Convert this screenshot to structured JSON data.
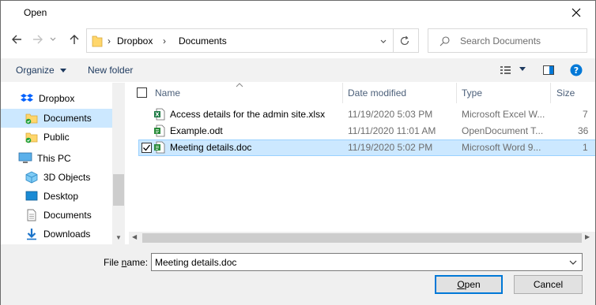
{
  "window": {
    "title": "Open"
  },
  "address": {
    "crumbs": [
      "Dropbox",
      "Documents"
    ],
    "separator": "›"
  },
  "search": {
    "placeholder": "Search Documents"
  },
  "toolbar": {
    "organize": "Organize",
    "new_folder": "New folder"
  },
  "nav": {
    "items": [
      {
        "label": "Dropbox",
        "icon": "dropbox-icon"
      },
      {
        "label": "Documents",
        "icon": "folder-icon",
        "selected": true
      },
      {
        "label": "Public",
        "icon": "folder-icon"
      },
      {
        "label": "This PC",
        "icon": "computer-icon"
      },
      {
        "label": "3D Objects",
        "icon": "3d-objects-icon"
      },
      {
        "label": "Desktop",
        "icon": "desktop-icon"
      },
      {
        "label": "Documents",
        "icon": "documents-icon"
      },
      {
        "label": "Downloads",
        "icon": "downloads-icon"
      }
    ]
  },
  "list": {
    "columns": [
      "Name",
      "Date modified",
      "Type",
      "Size"
    ],
    "rows": [
      {
        "name": "Access details for the admin site.xlsx",
        "date": "11/19/2020 5:03 PM",
        "type": "Microsoft Excel W...",
        "size": "7"
      },
      {
        "name": "Example.odt",
        "date": "11/11/2020 11:01 AM",
        "type": "OpenDocument T...",
        "size": "36"
      },
      {
        "name": "Meeting details.doc",
        "date": "11/19/2020 5:02 PM",
        "type": "Microsoft Word 9...",
        "size": "1",
        "selected": true
      }
    ]
  },
  "bottom": {
    "file_name_label_pre": "File ",
    "file_name_label_ul": "n",
    "file_name_label_post": "ame:",
    "file_name_value": "Meeting details.doc",
    "open_ul": "O",
    "open_rest": "pen",
    "cancel": "Cancel"
  },
  "colors": {
    "accent": "#0078d7",
    "selection": "#cce8ff",
    "toolbar": "#f2f2f2"
  }
}
